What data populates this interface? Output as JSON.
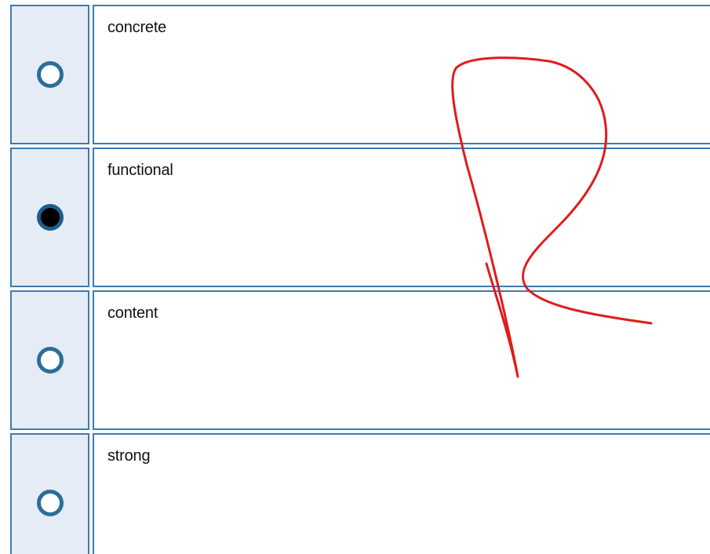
{
  "question": {
    "options": [
      {
        "label": "concrete",
        "selected": false,
        "selector_icon": "radio-unchecked-icon"
      },
      {
        "label": "functional",
        "selected": true,
        "selector_icon": "radio-checked-icon"
      },
      {
        "label": "content",
        "selected": false,
        "selector_icon": "radio-unchecked-icon"
      },
      {
        "label": "strong",
        "selected": false,
        "selector_icon": "radio-unchecked-icon"
      }
    ]
  },
  "annotation": {
    "type": "handwritten-red-stroke",
    "color": "#e11b1b"
  },
  "colors": {
    "border": "#3c7bb0",
    "selector_bg": "#e6ecf6",
    "radio_ring": "#2b6d9c"
  }
}
